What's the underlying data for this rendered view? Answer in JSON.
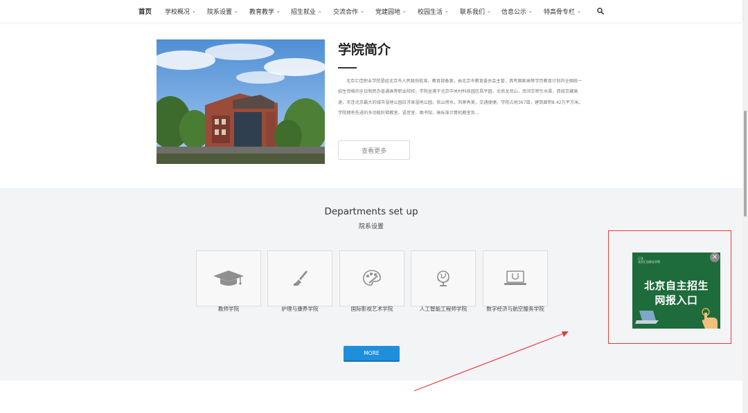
{
  "nav": {
    "items": [
      {
        "label": "首页",
        "dropdown": false
      },
      {
        "label": "学校概况",
        "dropdown": true
      },
      {
        "label": "院系设置",
        "dropdown": true
      },
      {
        "label": "教育教学",
        "dropdown": true
      },
      {
        "label": "招生就业",
        "dropdown": true
      },
      {
        "label": "交流合作",
        "dropdown": true
      },
      {
        "label": "党建园地",
        "dropdown": true
      },
      {
        "label": "校园生活",
        "dropdown": true
      },
      {
        "label": "联系我们",
        "dropdown": true
      },
      {
        "label": "信息公示",
        "dropdown": true
      },
      {
        "label": "特高骨专栏",
        "dropdown": true
      }
    ],
    "chevron": "⌄",
    "search_icon": "search-icon"
  },
  "about": {
    "title": "学院简介",
    "text": "北京汇佳职业学院是经北京市人民政府批准、教育部备案，由北京市教育委员会主管，具有国家高等学历教育计划内全国统一招生资格的全日制民办普通高等职业院校。学院坐落于北京中关村科技园区昌平园，北依龙凤山，南邻京密引水渠，西接京藏高速，东连北京最大的城市湿地公园白浮泉湿地公园，依山傍水，风景秀美，交通便捷。学院占地367亩，建筑面积8.42万平方米。学院拥有先进的多功能阶梯教室、语音室、图书馆、高标准计算机教室及...",
    "more_label": "查看更多"
  },
  "departments": {
    "title": "Departments set up",
    "subtitle": "院系设置",
    "items": [
      {
        "label": "教师学院",
        "icon": "graduation-cap-icon"
      },
      {
        "label": "护理与康养学院",
        "icon": "brush-icon"
      },
      {
        "label": "国际影视艺术学院",
        "icon": "palette-icon"
      },
      {
        "label": "人工智能工程师学院",
        "icon": "globe-icon"
      },
      {
        "label": "数字经济与航空服务学院",
        "icon": "laptop-icon"
      }
    ],
    "more_label": "MORE"
  },
  "ad": {
    "logo_line1": "汇佳",
    "logo_line2": "北京汇佳职业学院",
    "text_line1": "北京自主招生",
    "text_line2": "网报入口",
    "close": "×"
  },
  "colors": {
    "accent_blue": "#1f8fdc",
    "ad_green": "#1e6b3b",
    "annotation_red": "#e23b3b",
    "section_gray": "#f3f4f6"
  }
}
